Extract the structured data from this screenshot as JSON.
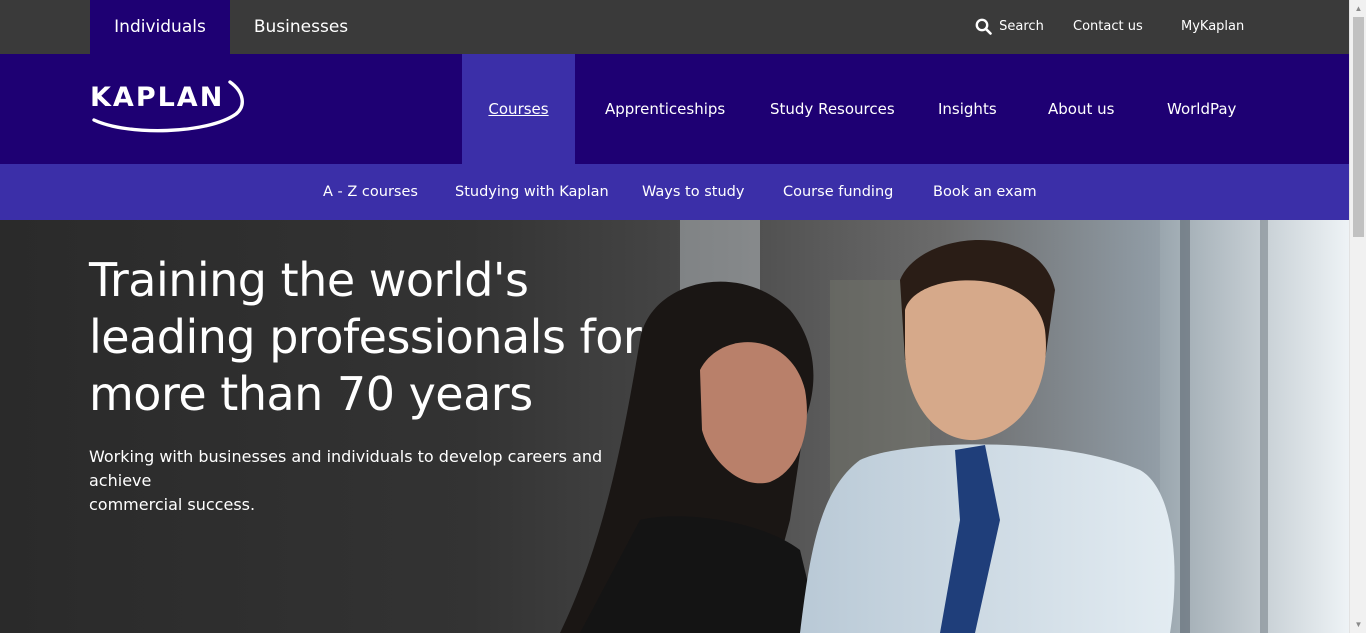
{
  "topbar": {
    "tabs": [
      {
        "label": "Individuals",
        "active": true
      },
      {
        "label": "Businesses",
        "active": false
      }
    ],
    "search_label": "Search",
    "contact_label": "Contact us",
    "mykaplan_label": "MyKaplan"
  },
  "logo": {
    "text": "KAPLAN"
  },
  "mainnav": {
    "items": [
      {
        "label": "Courses",
        "active": true
      },
      {
        "label": "Apprenticeships"
      },
      {
        "label": "Study Resources"
      },
      {
        "label": "Insights"
      },
      {
        "label": "About us"
      },
      {
        "label": "WorldPay"
      }
    ]
  },
  "subnav": {
    "items": [
      {
        "label": "A - Z courses"
      },
      {
        "label": "Studying with Kaplan"
      },
      {
        "label": "Ways to study"
      },
      {
        "label": "Course funding"
      },
      {
        "label": "Book an exam"
      }
    ]
  },
  "hero": {
    "title_lines": [
      "Training the world's",
      "leading professionals for",
      "more than 70 years"
    ],
    "subtitle_lines": [
      "Working with businesses and individuals to develop careers and achieve",
      "commercial success."
    ]
  },
  "colors": {
    "topbar_bg": "#3a3a3a",
    "brand_primary": "#1e0073",
    "brand_secondary": "#3b2fa8"
  }
}
